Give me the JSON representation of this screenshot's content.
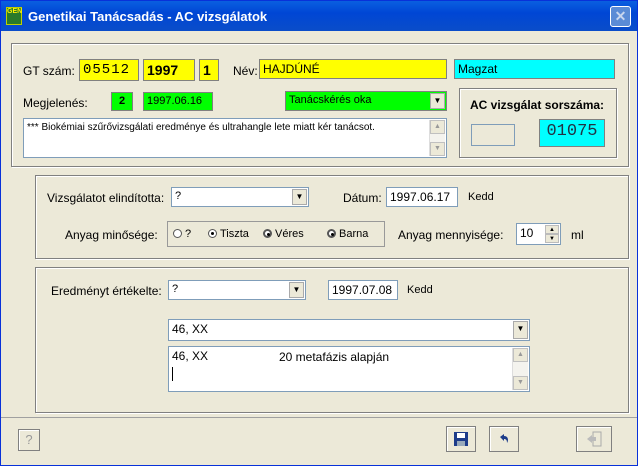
{
  "window": {
    "title": "Genetikai Tanácsadás - AC vizsgálatok",
    "icon_text": "GEN"
  },
  "patient": {
    "gt_label": "GT szám:",
    "gt_number": "05512",
    "gt_year": "1997",
    "gt_index": "1",
    "name_label": "Név:",
    "name": "HAJDÚNÉ",
    "fetus": "Magzat",
    "appearance_label": "Megjelenés:",
    "appearance_count": "2",
    "appearance_date": "1997.06.16",
    "reason_dropdown": "Tanácskérés oka",
    "note": "*** Biokémiai szűrővizsgálati eredménye és ultrahangle lete miatt kér tanácsot."
  },
  "ac": {
    "title": "AC vizsgálat sorszáma:",
    "prefix": "",
    "number": "01075"
  },
  "exam": {
    "initiated_label": "Vizsgálatot elindította:",
    "initiated_value": "?",
    "date_label": "Dátum:",
    "date_value": "1997.06.17",
    "date_day": "Kedd",
    "quality_label": "Anyag minősége:",
    "quality_options": [
      "?",
      "Tiszta",
      "Véres",
      "Barna"
    ],
    "quality_selected": "Tiszta",
    "amount_label": "Anyag mennyisége:",
    "amount_value": "10",
    "amount_unit": "ml"
  },
  "result": {
    "evaluated_label": "Eredményt értékelte:",
    "evaluated_value": "?",
    "date_value": "1997.07.08",
    "date_day": "Kedd",
    "karyotype_select": "46, XX",
    "text_line1_karyotype": "46, XX",
    "text_line1_comment": "20 metafázis alapján"
  },
  "footer": {
    "help": "?"
  }
}
